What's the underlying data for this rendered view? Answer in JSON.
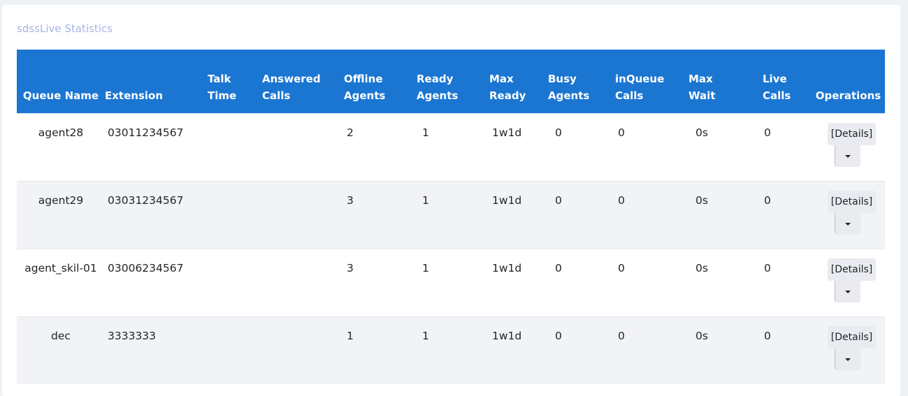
{
  "card": {
    "title": "sdssLive Statistics"
  },
  "table": {
    "headers": [
      {
        "line1": "",
        "line2": "Queue Name"
      },
      {
        "line1": "",
        "line2": "Extension"
      },
      {
        "line1": "Talk",
        "line2": "Time"
      },
      {
        "line1": "Answered",
        "line2": "Calls"
      },
      {
        "line1": "Offline",
        "line2": "Agents"
      },
      {
        "line1": "Ready",
        "line2": "Agents"
      },
      {
        "line1": "Max",
        "line2": "Ready"
      },
      {
        "line1": "Busy",
        "line2": "Agents"
      },
      {
        "line1": "inQueue",
        "line2": "Calls"
      },
      {
        "line1": "Max",
        "line2": "Wait"
      },
      {
        "line1": "Live",
        "line2": "Calls"
      },
      {
        "line1": "",
        "line2": "Operations"
      }
    ],
    "rows": [
      {
        "queue_name": "agent28",
        "extension": "03011234567",
        "talk_time": "",
        "answered_calls": "",
        "offline_agents": "2",
        "ready_agents": "1",
        "max_ready": "1w1d",
        "busy_agents": "0",
        "inqueue_calls": "0",
        "max_wait": "0s",
        "live_calls": "0",
        "details_label": "[Details]"
      },
      {
        "queue_name": "agent29",
        "extension": "03031234567",
        "talk_time": "",
        "answered_calls": "",
        "offline_agents": "3",
        "ready_agents": "1",
        "max_ready": "1w1d",
        "busy_agents": "0",
        "inqueue_calls": "0",
        "max_wait": "0s",
        "live_calls": "0",
        "details_label": "[Details]"
      },
      {
        "queue_name": "agent_skil-01",
        "extension": "03006234567",
        "talk_time": "",
        "answered_calls": "",
        "offline_agents": "3",
        "ready_agents": "1",
        "max_ready": "1w1d",
        "busy_agents": "0",
        "inqueue_calls": "0",
        "max_wait": "0s",
        "live_calls": "0",
        "details_label": "[Details]"
      },
      {
        "queue_name": "dec",
        "extension": "3333333",
        "talk_time": "",
        "answered_calls": "",
        "offline_agents": "1",
        "ready_agents": "1",
        "max_ready": "1w1d",
        "busy_agents": "0",
        "inqueue_calls": "0",
        "max_wait": "0s",
        "live_calls": "0",
        "details_label": "[Details]"
      }
    ]
  },
  "colors": {
    "header_bg": "#1b76d2",
    "title": "#a7b4e6"
  }
}
